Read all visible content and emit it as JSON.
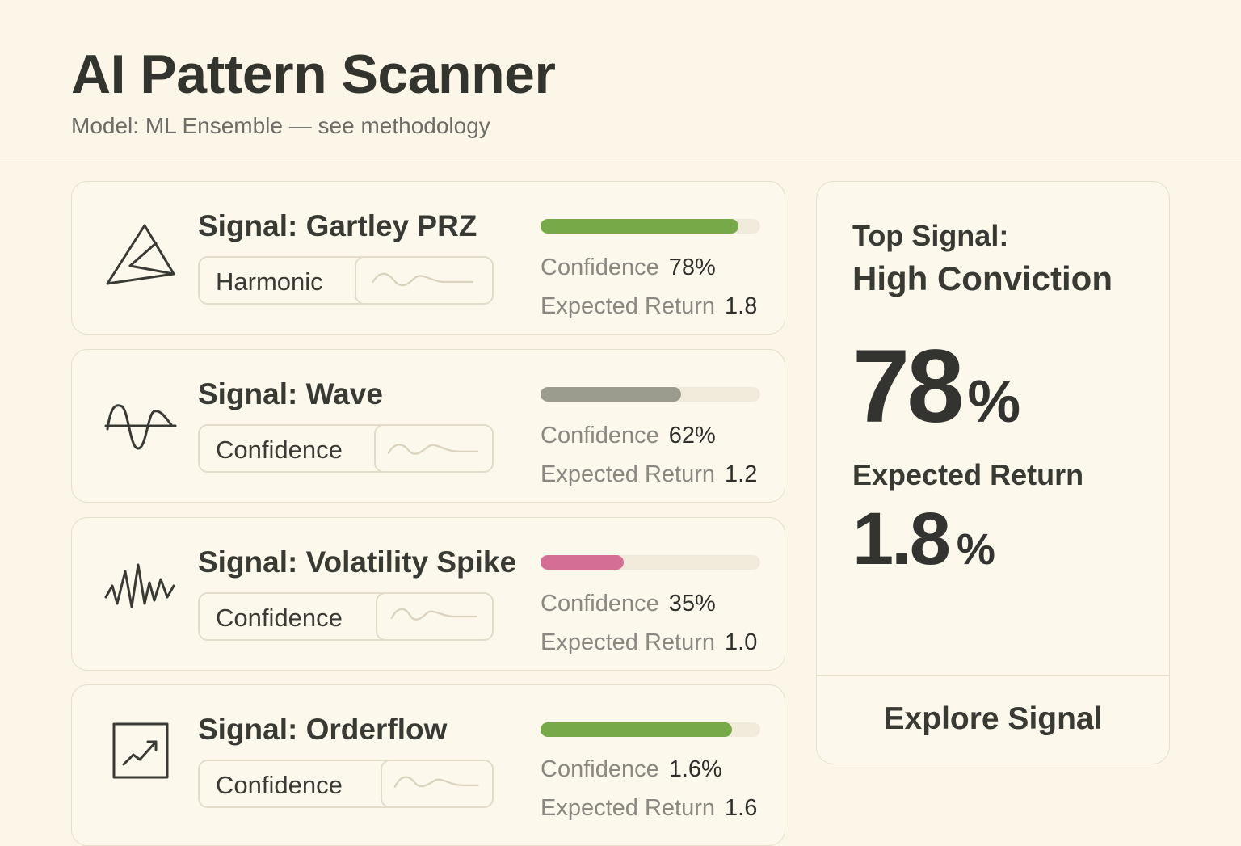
{
  "header": {
    "title": "AI Pattern Scanner",
    "subtitle": "Model: ML Ensemble — see methodology"
  },
  "signals": [
    {
      "title": "Signal: Gartley PRZ",
      "tag": "Harmonic",
      "icon": "harmonic-triangle-icon",
      "confidence_label": "Confidence",
      "confidence": "78%",
      "confidence_fraction": 0.9,
      "return_label": "Expected Return",
      "expected_return": "1.8",
      "bar_color": "#78a949"
    },
    {
      "title": "Signal: Wave",
      "tag": "Confidence",
      "icon": "sine-wave-icon",
      "confidence_label": "Confidence",
      "confidence": "62%",
      "confidence_fraction": 0.64,
      "return_label": "Expected Return",
      "expected_return": "1.2",
      "bar_color": "#9b9c8e"
    },
    {
      "title": "Signal: Volatility Spike",
      "tag": "Confidence",
      "icon": "volatility-zigzag-icon",
      "confidence_label": "Confidence",
      "confidence": "35%",
      "confidence_fraction": 0.38,
      "return_label": "Expected Return",
      "expected_return": "1.0",
      "bar_color": "#d56e95"
    },
    {
      "title": "Signal: Orderflow",
      "tag": "Confidence",
      "icon": "trend-chart-icon",
      "confidence_label": "Confidence",
      "confidence": "1.6%",
      "confidence_fraction": 0.87,
      "return_label": "Expected Return",
      "expected_return": "1.6",
      "bar_color": "#78a949"
    }
  ],
  "top_signal": {
    "label": "Top Signal:",
    "value": "High Conviction",
    "confidence_number": "78",
    "confidence_unit": "%",
    "return_label": "Expected Return",
    "return_number": "1.8",
    "return_unit": "%",
    "action": "Explore Signal"
  }
}
